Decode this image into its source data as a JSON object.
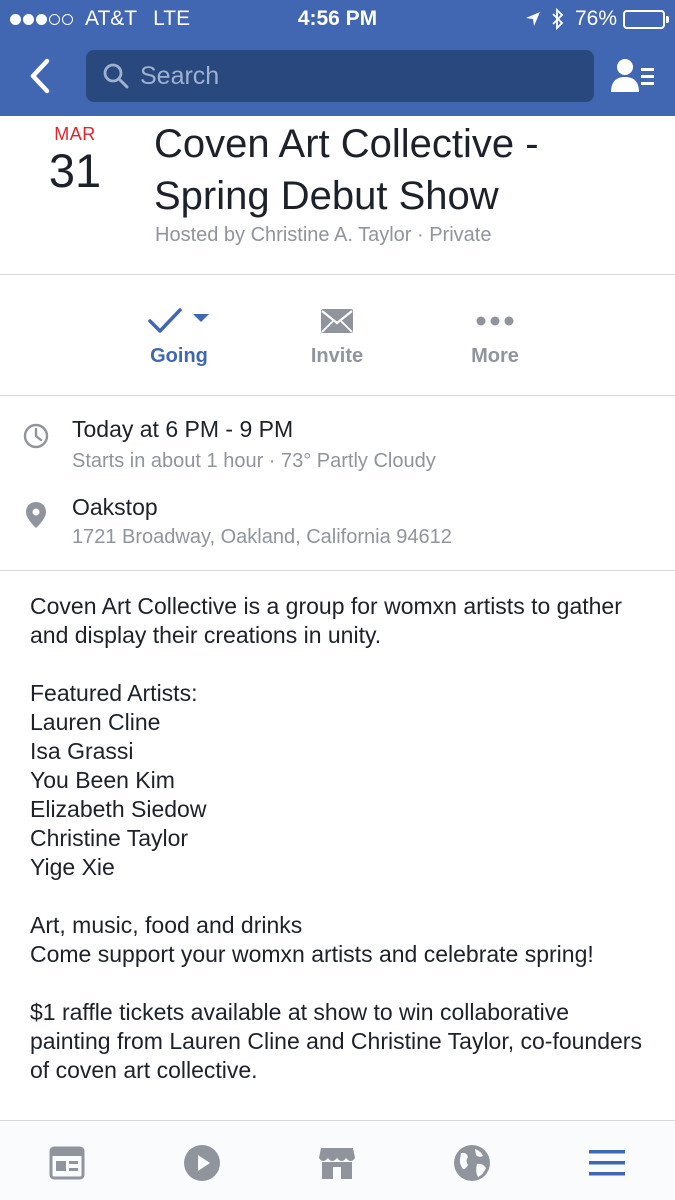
{
  "status_bar": {
    "carrier": "AT&T",
    "network": "LTE",
    "time": "4:56 PM",
    "battery": "76%",
    "battery_level": 0.76
  },
  "nav": {
    "search_placeholder": "Search",
    "accent_color": "#4267b2"
  },
  "event": {
    "month": "MAR",
    "day": "31",
    "title": "Coven Art Collective - Spring Debut Show",
    "host": "Hosted by Christine A. Taylor · Private"
  },
  "actions": [
    {
      "label": "Going",
      "icon": "check-icon"
    },
    {
      "label": "Invite",
      "icon": "envelope-icon"
    },
    {
      "label": "More",
      "icon": "more-icon"
    }
  ],
  "details": {
    "time_main": "Today at 6 PM - 9 PM",
    "time_sub": "Starts in about 1 hour · 73° Partly Cloudy",
    "location_main": "Oakstop",
    "location_sub": "1721 Broadway, Oakland, California 94612"
  },
  "description": {
    "intro": "Coven Art Collective is a group for womxn artists to gather and display their creations in unity.",
    "featured_heading": "Featured Artists:",
    "artists": [
      "Lauren Cline",
      "Isa Grassi",
      "You Been Kim",
      "Elizabeth Siedow",
      "Christine Taylor",
      "Yige Xie"
    ],
    "line_1": "Art, music, food and drinks",
    "line_2": "Come support your womxn artists and celebrate spring!",
    "raffle": "$1 raffle tickets available at show to win collaborative painting from Lauren Cline and Christine Taylor, co-founders of coven art collective."
  },
  "tab_bar": {
    "tabs": [
      "news-feed-icon",
      "video-icon",
      "marketplace-icon",
      "globe-icon",
      "menu-icon"
    ],
    "active": "menu-icon"
  }
}
